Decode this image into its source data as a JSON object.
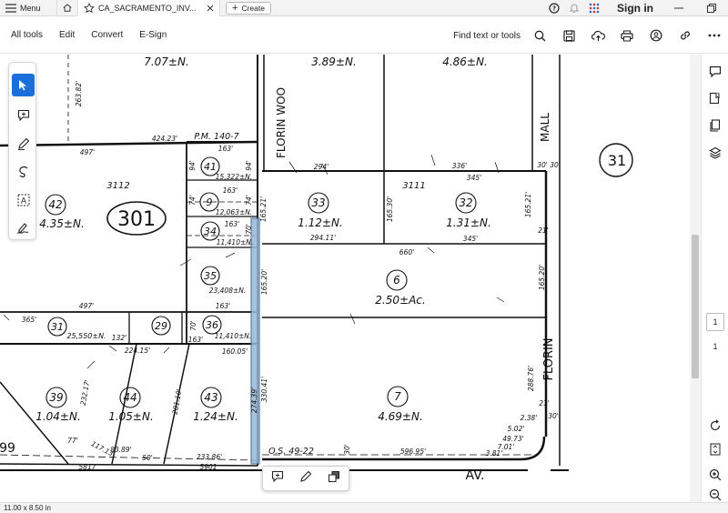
{
  "titlebar": {
    "menu_label": "Menu",
    "tab_title": "CA_SACRAMENTO_INV...",
    "create_label": "Create",
    "signin_label": "Sign in"
  },
  "menubar": {
    "items": [
      "All tools",
      "Edit",
      "Convert",
      "E-Sign"
    ],
    "find_label": "Find text or tools"
  },
  "page_nav": {
    "current_page": "1",
    "total_pages": "1"
  },
  "statusbar": {
    "page_size": "11.00 x 8.50 in"
  },
  "map": {
    "parcels": [
      {
        "num": "42",
        "area": "4.35±N."
      },
      {
        "num": "41",
        "area": "15,322±N."
      },
      {
        "num": "9",
        "area": "12,063±N."
      },
      {
        "num": "34",
        "area": "11,410±N."
      },
      {
        "num": "35",
        "area": "23,408±N."
      },
      {
        "num": "36",
        "area": "11,410±N."
      },
      {
        "num": "31",
        "area": "25,550±N."
      },
      {
        "num": "29",
        "area": ""
      },
      {
        "num": "33",
        "area": "1.12±N."
      },
      {
        "num": "32",
        "area": "1.31±N."
      },
      {
        "num": "6",
        "area": "2.50±Ac."
      },
      {
        "num": "7",
        "area": "4.69±N."
      },
      {
        "num": "39",
        "area": "1.04±N."
      },
      {
        "num": "44",
        "area": "1.05±N."
      },
      {
        "num": "43",
        "area": "1.24±N."
      }
    ],
    "areas_top": [
      "7.07±N.",
      "3.89±N.",
      "4.86±N."
    ],
    "block_numbers": [
      "301",
      "31"
    ],
    "book_numbers": [
      "3112",
      "3111"
    ],
    "streets": [
      "FLORIN WOO",
      "MALL",
      "FLORIN",
      "AV."
    ],
    "references": [
      "P.M. 140-7",
      "O.S. 49-22"
    ],
    "dimensions": {
      "d497a": "497'",
      "d42423": "424.23'",
      "d163a": "163'",
      "d294": "294'",
      "d336": "336'",
      "d30a": "30'",
      "d30b": "30'",
      "d94a": "94'",
      "d94b": "94'",
      "d74a": "74'",
      "d74b": "74'",
      "d163b": "163'",
      "d163c": "163'",
      "d70a": "70'",
      "d16521": "165.21'",
      "d16530": "165.30'",
      "d345a": "345'",
      "d16521b": "165.21'",
      "d21a": "21'",
      "d29411": "294.11'",
      "d660": "660'",
      "d345b": "345'",
      "d16520": "165.20'",
      "d16520b": "165.20'",
      "d163d": "163'",
      "d497b": "497'",
      "d365": "365'",
      "d132": "132'",
      "d70b": "70'",
      "d163e": "163'",
      "d16005": "160.05'",
      "d22415": "224.15'",
      "d33041": "330.41'",
      "d27439": "274.39'",
      "d28876": "288.76'",
      "d21b": "21'",
      "d30c": "30'",
      "d238": "2.38'",
      "d502": "5.02'",
      "d4973": "49.73'",
      "d701": "7.01'",
      "d381": "3.81'",
      "d59695": "596.95'",
      "d30d": "30'",
      "d23386": "233.86'",
      "d50": "50'",
      "d8389": "83.89'",
      "d11713": "117.13'",
      "d77": "77'",
      "d23217": "232.17'",
      "d28110": "281.10'",
      "d5817": "5817",
      "d5901": "5901",
      "d26382": "263.82'",
      "d99": "99"
    }
  }
}
